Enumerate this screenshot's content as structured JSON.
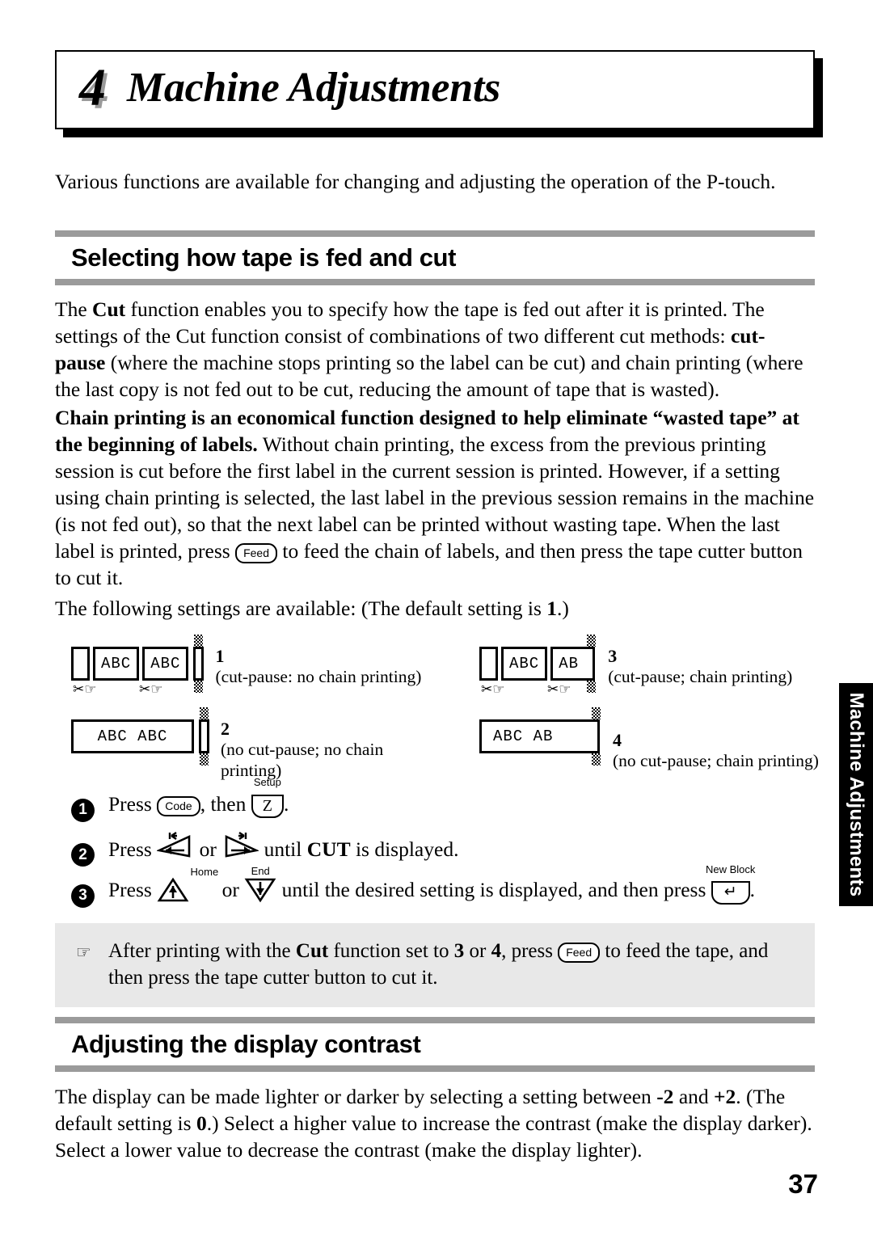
{
  "chapter": {
    "number": "4",
    "title": "Machine Adjustments",
    "side_tab": "Machine Adjustments"
  },
  "intro": "Various functions are available for changing and adjusting the operation of the P-touch.",
  "sections": [
    {
      "heading": "Selecting how tape is fed and cut",
      "paragraph1_pre": "The ",
      "paragraph1_bold1": "Cut",
      "paragraph1_mid1": " function enables you to specify how the tape is fed out after it is printed. The settings of the Cut function consist of combinations of two different cut methods: ",
      "paragraph1_bold2": "cut-pause",
      "paragraph1_end": " (where the machine stops printing so the label can be cut) and chain printing (where the last copy is not fed out to be cut, reducing the amount of tape that is wasted).",
      "paragraph2_bold": "Chain printing is an economical function designed to help eliminate “wasted tape” at the beginning of labels.",
      "paragraph2_mid": " Without chain printing, the excess from the previous printing session is cut before the first label in the current session is printed. However, if a setting using chain printing is selected, the last label in the previous session remains in the machine (is not fed out), so that the next label can be printed without wasting tape. When the last label is printed, press ",
      "paragraph2_key": "Feed",
      "paragraph2_end": " to feed the chain of labels, and then press the tape cutter button to cut it.",
      "available_pre": "The following settings are available: (The default setting is ",
      "available_bold": "1",
      "available_post": ".)"
    },
    {
      "heading": "Adjusting the display contrast",
      "paragraph_pre": "The display can be made lighter or darker by selecting a setting between ",
      "paragraph_bold1": "-2",
      "paragraph_mid1": " and ",
      "paragraph_bold2": "+2",
      "paragraph_mid2": ". (The default setting is ",
      "paragraph_bold3": "0",
      "paragraph_end": ".) Select a higher value to increase the contrast (make the display darker). Select a lower value to decrease the contrast (make the display lighter)."
    }
  ],
  "cut_settings": [
    {
      "number": "1",
      "description": "(cut-pause: no chain printing)",
      "segments": [
        "ABC",
        "ABC"
      ],
      "leading_blank": true,
      "clipped": false,
      "cut_marks": [
        "✂☞",
        "✂☞"
      ]
    },
    {
      "number": "3",
      "description": "(cut-pause; chain printing)",
      "segments": [
        "ABC",
        "AB"
      ],
      "leading_blank": true,
      "clipped": true,
      "cut_marks": [
        "✂☞",
        "✂☞"
      ]
    },
    {
      "number": "2",
      "description": "(no cut-pause; no chain printing)",
      "segments": [
        "ABC ABC"
      ],
      "leading_blank": false,
      "clipped": false,
      "cut_marks": []
    },
    {
      "number": "4",
      "description": "(no cut-pause; chain printing)",
      "segments": [
        "ABC AB"
      ],
      "leading_blank": false,
      "clipped": true,
      "cut_marks": []
    }
  ],
  "steps": [
    {
      "bullet": "1",
      "pre": "Press ",
      "key1": "Code",
      "mid": ", then ",
      "key2": "Z",
      "key2_sup": "Setup",
      "post": "."
    },
    {
      "bullet": "2",
      "pre": "Press ",
      "key1_sup": "",
      "mid": " or ",
      "post_bold": "CUT",
      "post_pre": " until ",
      "post_end": " is displayed."
    },
    {
      "bullet": "3",
      "pre": "Press ",
      "key1_sup": "Home",
      "mid": " or ",
      "key2_sup": "End",
      "post": " until the desired setting is displayed, and then press ",
      "key3_sup": "New Block",
      "end": "."
    }
  ],
  "note": {
    "icon": "☞",
    "pre": "After printing with the ",
    "bold1": "Cut",
    "mid1": " function set to ",
    "bold2": "3",
    "mid2": " or ",
    "bold3": "4",
    "mid3": ", press ",
    "key": "Feed",
    "end": " to feed the tape, and then press the tape cutter button to cut it."
  },
  "page_number": "37",
  "colors": {
    "rule_gray": "#9b9b9b",
    "note_bg": "#e8e8e8",
    "tab_bg": "#000000"
  }
}
